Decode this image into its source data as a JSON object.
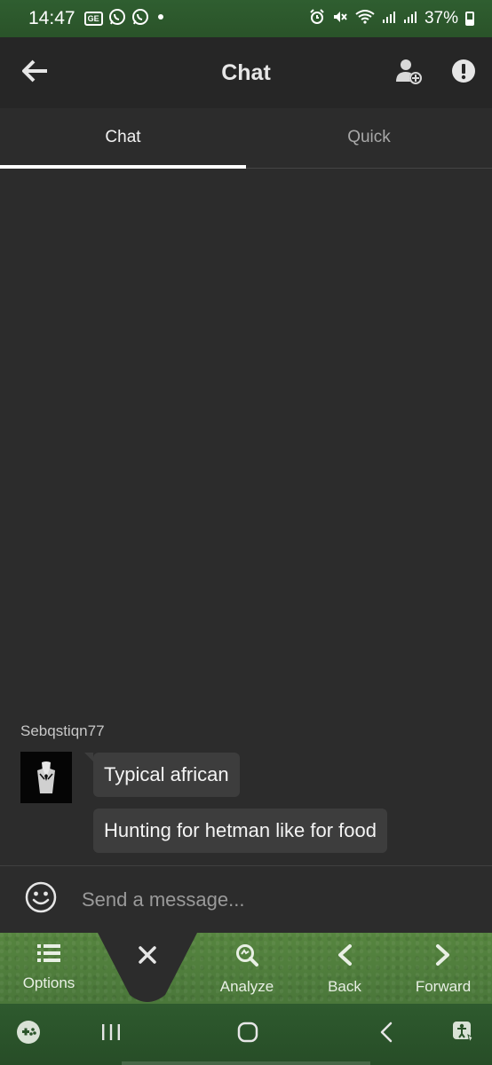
{
  "status_bar": {
    "time": "14:47",
    "left_icons": [
      "ge-icon",
      "whatsapp-icon",
      "whatsapp-icon",
      "dot-icon"
    ],
    "right_icons": [
      "alarm-icon",
      "mute-icon",
      "wifi-icon",
      "signal-icon",
      "signal-r-icon"
    ],
    "battery_percent": "37%"
  },
  "app_bar": {
    "title": "Chat",
    "back_icon": "arrow-left-icon",
    "add_user_icon": "add-user-icon",
    "report_icon": "exclamation-icon"
  },
  "tabs": [
    {
      "label": "Chat",
      "active": true
    },
    {
      "label": "Quick",
      "active": false
    }
  ],
  "messages": {
    "username": "Sebqstiqn77",
    "items": [
      {
        "text": "Typical african"
      },
      {
        "text": "Hunting for hetman like for food"
      }
    ]
  },
  "input": {
    "placeholder": "Send a message...",
    "emoji_icon": "smiley-icon"
  },
  "toolbar": {
    "options": "Options",
    "close_icon": "close-icon",
    "analyze": "Analyze",
    "back": "Back",
    "forward": "Forward"
  },
  "system_nav": {
    "icons": [
      "gamepad-icon",
      "recents-icon",
      "home-icon",
      "back-icon",
      "accessibility-icon"
    ]
  },
  "colors": {
    "background": "#2c2c2c",
    "app_bar": "#262626",
    "bubble": "#3d3d3d",
    "felt_green": "#4a7a3a"
  }
}
